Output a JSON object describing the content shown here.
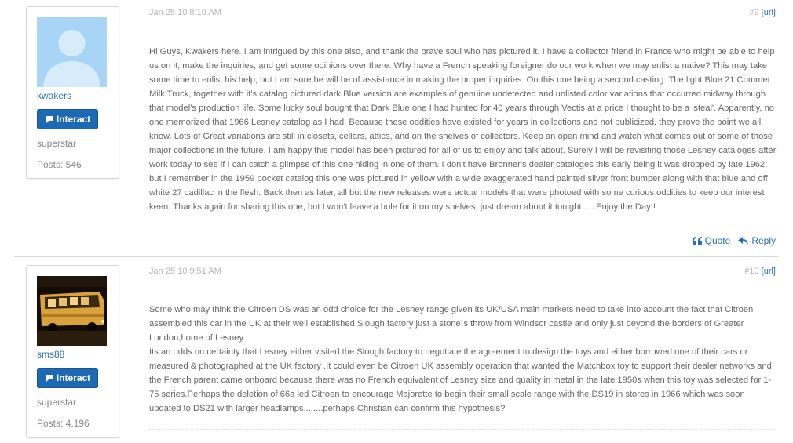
{
  "posts": [
    {
      "date": "Jan 25 10 8:10 AM",
      "number": "#9",
      "url_label": "[url]",
      "author": {
        "username": "kwakers",
        "rank": "superstar",
        "posts": "Posts: 546",
        "avatar": "default-avatar-icon"
      },
      "interact_label": "Interact",
      "body": "Hi Guys, Kwakers here. I am intrigued by this one also, and thank the brave soul who has pictured it. I have a collector friend in France who might be able to help us on it, make the inquiries, and get some opinions over there. Why have a French speaking foreigner do our work when we may enlist a native?  This may take some time to enlist his help, but I am sure he will be of assistance in making the proper inquiries. On this one being a second casting: The light Blue 21 Commer Milk Truck, together with it's catalog pictured dark Blue version are examples of genuine undetected and unlisted color variations that occurred midway through that model's production life. Some lucky soul bought that Dark Blue one I had hunted for 40 years through Vectis at a price I thought to be a 'steal'. Apparently, no one memorized that 1966 Lesney catalog as I had. Because these oddities have existed for years in collections and not publicized, they prove the point we all know. Lots of Great variations are still in closets, cellars, attics, and on the shelves of collectors. Keep an open mind and watch what comes out of some of those major collections in the future. I am happy this model has been pictured for all of us to enjoy and  talk about. Surely I will be revisiting those Lesney cataloges after work today to see if I can catch a glimpse of this one hiding in one of them. I don't have Bronner's dealer cataloges this early being it was dropped by late 1962, but I remember in the 1959 pocket catalog this one was pictured in yellow with a wide exaggerated hand painted silver front bumper along with that blue and off white 27 cadillac in the flesh. Back then as later, all but the new releases were actual models that were photoed with some curious oddities to keep our interest keen. Thanks again for sharing this one, but I won't leave a hole for it on my shelves, just dream about it tonight......Enjoy the Day!!",
      "quote_label": "Quote",
      "reply_label": "Reply"
    },
    {
      "date": "Jan 25 10 9:51 AM",
      "number": "#10",
      "url_label": "[url]",
      "author": {
        "username": "sms88",
        "rank": "superstar",
        "posts": "Posts: 4,196",
        "avatar": "bus-photo-avatar"
      },
      "interact_label": "Interact",
      "body": "Some who may think the Citroen DS was an odd choice for the Lesney range given its UK/USA main markets need to take into account the fact that Citroen assembled this car in the UK at their well established Slough factory just a stone´s throw from Windsor castle and only just beyond the borders of Greater London,home of Lesney.\nIts an odds on certainty that Lesney either visited the Slough factory to negotiate the agreement to design the toys and either borrowed one of their cars or measured & photographed at the UK factory .It could even be Citroen UK assembly operation that wanted the Matchbox toy to support their dealer networks and the French parent came onboard because there was no French equivalent of Lesney size and quality in metal in the late 1950s when this toy was selected for 1-75 series.Perhaps the deletion of 66a led Citroen to encourage Majorette to begin their small scale range with the DS19 in stores in 1966 which was soon updated to DS21 with larger headlamps........perhaps Christian can confirm this hypothesis?"
    }
  ],
  "colors": {
    "link": "#2a6fb0",
    "button": "#1e69b5",
    "muted": "#b5b5b5",
    "body_text": "#666666"
  },
  "icons": {
    "interact": "chat-bubble-icon",
    "quote": "quote-icon",
    "reply": "reply-arrow-icon"
  }
}
